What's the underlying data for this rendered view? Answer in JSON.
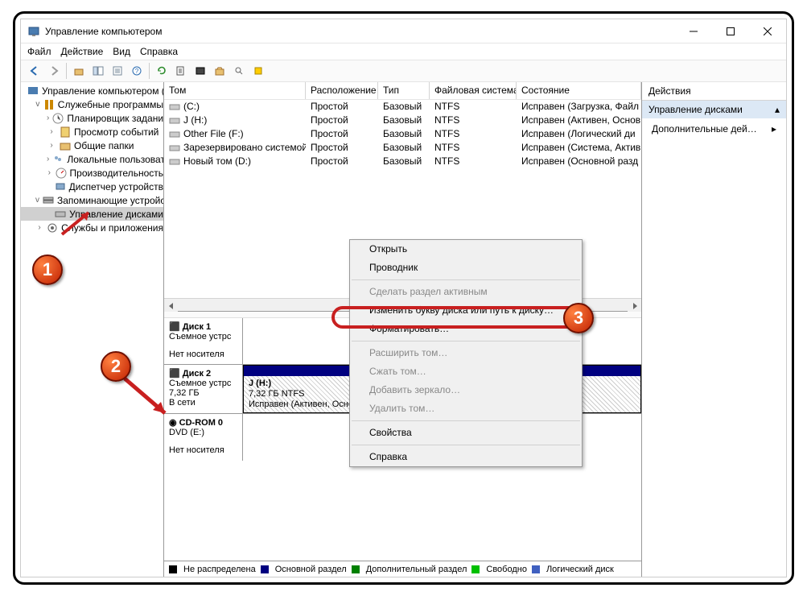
{
  "titlebar": {
    "title": "Управление компьютером"
  },
  "menu": {
    "file": "Файл",
    "action": "Действие",
    "view": "Вид",
    "help": "Справка"
  },
  "tree": {
    "root": "Управление компьютером (л",
    "sys": "Служебные программы",
    "sched": "Планировщик заданий",
    "events": "Просмотр событий",
    "shared": "Общие папки",
    "localusers": "Локальные пользовате",
    "perf": "Производительность",
    "devmgr": "Диспетчер устройств",
    "storage": "Запоминающие устройст",
    "diskmgmt": "Управление дисками",
    "services": "Службы и приложения"
  },
  "listHeaders": {
    "volume": "Том",
    "layout": "Расположение",
    "type": "Тип",
    "fs": "Файловая система",
    "status": "Состояние"
  },
  "volumes": [
    {
      "name": "(C:)",
      "layout": "Простой",
      "type": "Базовый",
      "fs": "NTFS",
      "status": "Исправен (Загрузка, Файл"
    },
    {
      "name": "J (H:)",
      "layout": "Простой",
      "type": "Базовый",
      "fs": "NTFS",
      "status": "Исправен (Активен, Основ"
    },
    {
      "name": "Other File (F:)",
      "layout": "Простой",
      "type": "Базовый",
      "fs": "NTFS",
      "status": "Исправен (Логический ди"
    },
    {
      "name": "Зарезервировано системой",
      "layout": "Простой",
      "type": "Базовый",
      "fs": "NTFS",
      "status": "Исправен (Система, Актив"
    },
    {
      "name": "Новый том (D:)",
      "layout": "Простой",
      "type": "Базовый",
      "fs": "NTFS",
      "status": "Исправен (Основной разд"
    }
  ],
  "disks": {
    "d1": {
      "name": "Диск 1",
      "type": "Съемное устрс",
      "nomedia": "Нет носителя"
    },
    "d2": {
      "name": "Диск 2",
      "type": "Съемное устрс",
      "size": "7,32 ГБ",
      "state": "В сети",
      "part": {
        "label": "J  (H:)",
        "size": "7,32 ГБ NTFS",
        "status": "Исправен (Активен, Основной раздел)"
      }
    },
    "cd": {
      "name": "CD-ROM 0",
      "type": "DVD (E:)",
      "nomedia": "Нет носителя"
    }
  },
  "legend": {
    "unalloc": "Не распределена",
    "primary": "Основной раздел",
    "extended": "Дополнительный раздел",
    "free": "Свободно",
    "logical": "Логический диск"
  },
  "actions": {
    "header": "Действия",
    "sub": "Управление дисками",
    "more": "Дополнительные дей…"
  },
  "ctx": {
    "open": "Открыть",
    "explorer": "Проводник",
    "active": "Сделать раздел активным",
    "letter": "Изменить букву диска или путь к диску…",
    "format": "Форматировать…",
    "extend": "Расширить том…",
    "shrink": "Сжать том…",
    "mirror": "Добавить зеркало…",
    "delete": "Удалить том…",
    "props": "Свойства",
    "help": "Справка"
  }
}
